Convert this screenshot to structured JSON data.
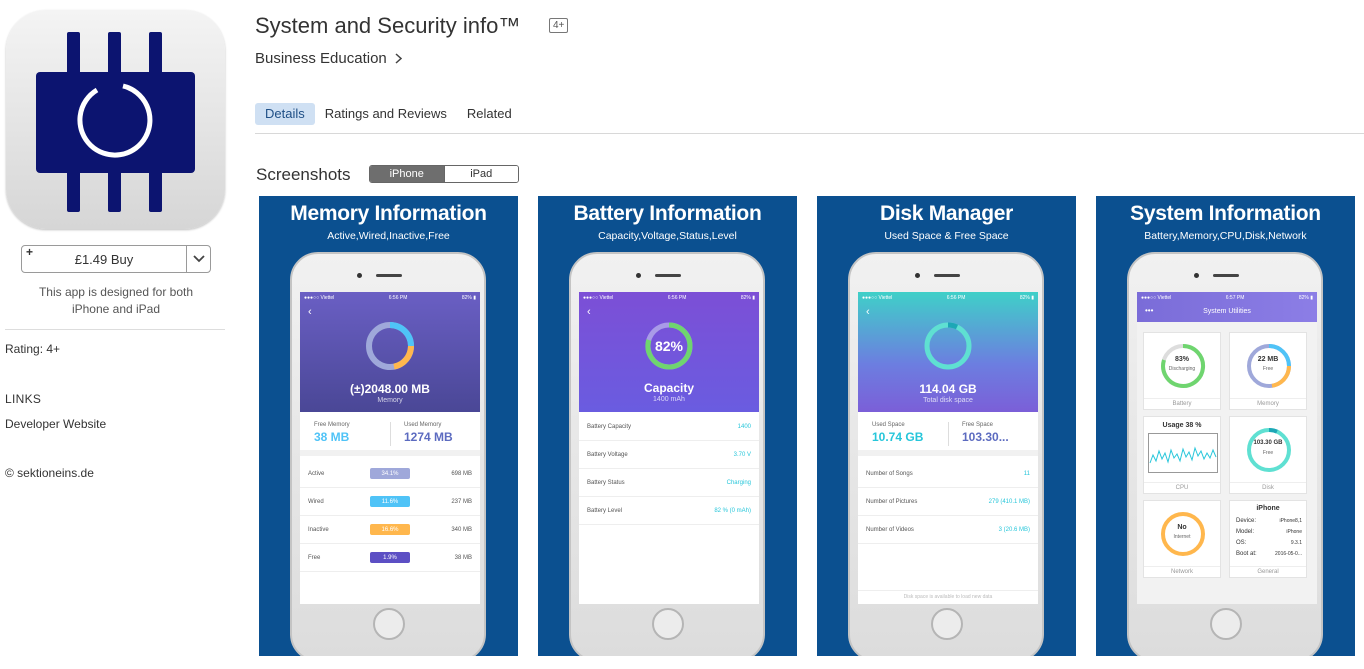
{
  "app": {
    "title": "System and Security info™",
    "age_badge": "4+",
    "category": "Business Education",
    "category_chevron": "chevron-right-icon"
  },
  "tabs": [
    {
      "label": "Details",
      "active": true
    },
    {
      "label": "Ratings and Reviews",
      "active": false
    },
    {
      "label": "Related",
      "active": false
    }
  ],
  "sidebar": {
    "buy_price": "£1.49 Buy",
    "buy_plus": "+",
    "designed_for": "This app is designed for both iPhone and iPad",
    "rating": "Rating:  4+",
    "links_heading": "LINKS",
    "developer_website": "Developer Website",
    "copyright": "© sektioneins.de"
  },
  "screenshots": {
    "heading": "Screenshots",
    "toggle": {
      "iphone": "iPhone",
      "ipad": "iPad",
      "selected": "iPhone"
    },
    "items": [
      {
        "title": "Memory Information",
        "subtitle": "Active,Wired,Inactive,Free",
        "status_carrier": "●●●○○ Viettel",
        "status_time": "6:56 PM",
        "status_battery": "82% ▮",
        "hero_value": "(±)2048.00 MB",
        "hero_label": "Memory",
        "left_label": "Free Memory",
        "left_value": "38 MB",
        "right_label": "Used Memory",
        "right_value": "1274 MB",
        "rows": [
          {
            "label": "Active",
            "pill": "34.1%",
            "value": "698 MB"
          },
          {
            "label": "Wired",
            "pill": "11.6%",
            "value": "237 MB"
          },
          {
            "label": "Inactive",
            "pill": "16.6%",
            "value": "340 MB"
          },
          {
            "label": "Free",
            "pill": "1.9%",
            "value": "38 MB"
          }
        ]
      },
      {
        "title": "Battery Information",
        "subtitle": "Capacity,Voltage,Status,Level",
        "status_carrier": "●●●○○ Viettel",
        "status_time": "6:56 PM",
        "status_battery": "82% ▮",
        "ring_value": "82%",
        "hero_value": "Capacity",
        "hero_label": "1400 mAh",
        "rows": [
          {
            "label": "Battery Capacity",
            "value": "1400"
          },
          {
            "label": "Battery Voltage",
            "value": "3.70 V"
          },
          {
            "label": "Battery Status",
            "value": "Charging"
          },
          {
            "label": "Battery Level",
            "value": "82 % (0 mAh)"
          }
        ]
      },
      {
        "title": "Disk Manager",
        "subtitle": "Used Space & Free Space",
        "status_carrier": "●●●○○ Viettel",
        "status_time": "6:56 PM",
        "status_battery": "82% ▮",
        "hero_value": "114.04 GB",
        "hero_label": "Total disk space",
        "left_label": "Used Space",
        "left_value": "10.74 GB",
        "right_label": "Free Space",
        "right_value": "103.30...",
        "rows": [
          {
            "label": "Number of Songs",
            "value": "11"
          },
          {
            "label": "Number of Pictures",
            "value": "279 (410.1 MB)"
          },
          {
            "label": "Number of Videos",
            "value": "3 (20.6 MB)"
          }
        ],
        "footer": "Disk space is available to load new data"
      },
      {
        "title": "System Information",
        "subtitle": "Battery,Memory,CPU,Disk,Network",
        "status_carrier": "●●●○○ Viettel",
        "status_time": "6:57 PM",
        "status_battery": "82% ▮",
        "header": "System Utilities",
        "menu_dots": "•••",
        "cells": {
          "battery": {
            "ring": "83%",
            "sub": "Discharging",
            "label": "Battery"
          },
          "memory": {
            "ring": "22 MB",
            "sub": "Free",
            "label": "Memory"
          },
          "cpu": {
            "usage": "Usage 38 %",
            "label": "CPU"
          },
          "disk": {
            "ring": "103.30 GB",
            "sub": "Free",
            "label": "Disk"
          },
          "network": {
            "ring": "No",
            "sub": "Internet",
            "label": "Network"
          },
          "general": {
            "heading": "iPhone",
            "device_k": "Device:",
            "device_v": "iPhone8,1",
            "model_k": "Model:",
            "model_v": "iPhone",
            "os_k": "OS:",
            "os_v": "9.3.1",
            "boot_k": "Boot at:",
            "boot_v": "2016-05-0...",
            "label": "General"
          }
        }
      }
    ]
  },
  "colors": {
    "screenshot_bg": "#0b5090",
    "icon_navy": "#0c1470",
    "tab_active_bg": "#cfe0f3",
    "memory_accent": "#4fc3f7",
    "memory_used": "#5c6bc0",
    "battery_ring": "#6fd56f",
    "disk_accent": "#26c6da"
  }
}
